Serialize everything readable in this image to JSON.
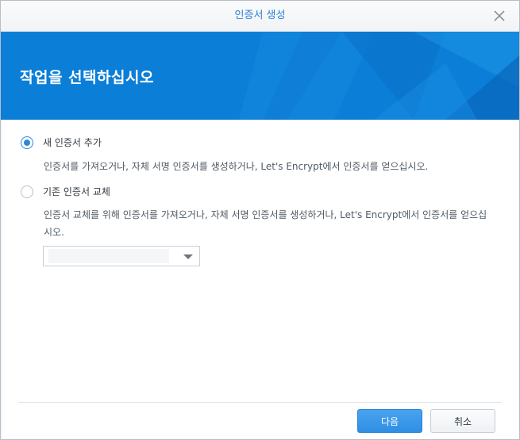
{
  "dialog": {
    "title": "인증서 생성",
    "close_icon": "close-icon"
  },
  "banner": {
    "heading": "작업을 선택하십시오",
    "accent_color": "#0b7fd8"
  },
  "options": [
    {
      "label": "새 인증서 추가",
      "checked": true,
      "description": "인증서를 가져오거나, 자체 서명 인증서를 생성하거나, Let's Encrypt에서 인증서를 얻으십시오."
    },
    {
      "label": "기존 인증서 교체",
      "checked": false,
      "description": "인증서 교체를 위해 인증서를 가져오거나, 자체 서명 인증서를 생성하거나, Let's Encrypt에서 인증서를 얻으십시오."
    }
  ],
  "certificate_select": {
    "value": "",
    "icon": "chevron-down-icon"
  },
  "footer": {
    "next_label": "다음",
    "cancel_label": "취소"
  }
}
